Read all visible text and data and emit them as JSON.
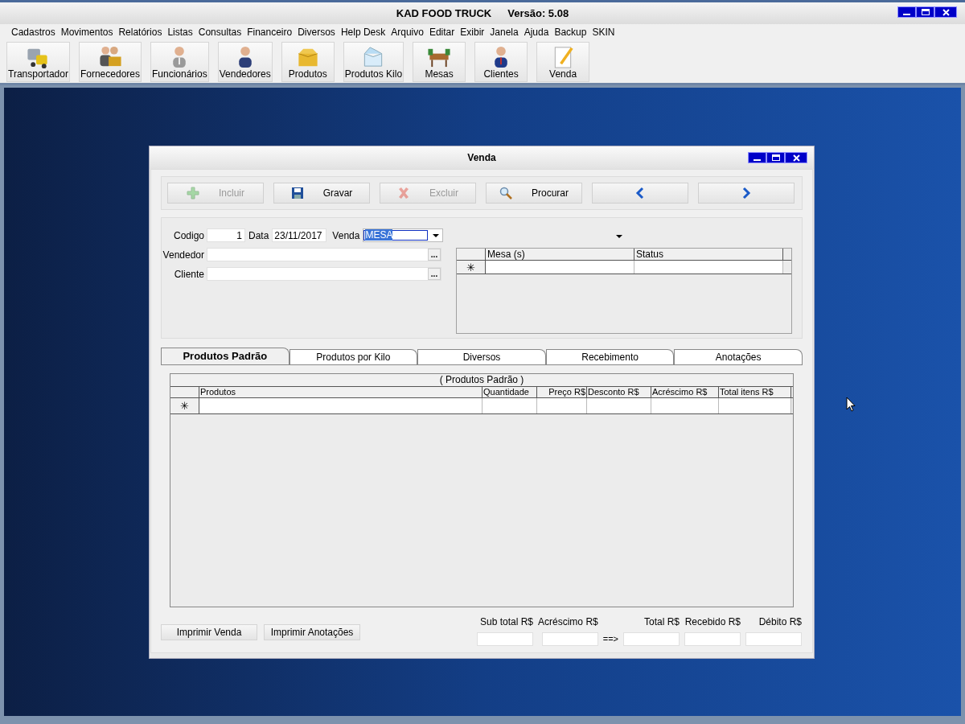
{
  "app": {
    "title": "KAD FOOD TRUCK",
    "version": "Versão: 5.08"
  },
  "menu": [
    "Cadastros",
    "Movimentos",
    "Relatórios",
    "Listas",
    "Consultas",
    "Financeiro",
    "Diversos",
    "Help Desk",
    "Arquivo",
    "Editar",
    "Exibir",
    "Janela",
    "Ajuda",
    "Backup",
    "SKIN"
  ],
  "toolbar": [
    {
      "label": "Transportador",
      "kind": "truck"
    },
    {
      "label": "Fornecedores",
      "kind": "suppliers"
    },
    {
      "label": "Funcionários",
      "kind": "employee"
    },
    {
      "label": "Vendedores",
      "kind": "seller"
    },
    {
      "label": "Produtos",
      "kind": "box"
    },
    {
      "label": "Produtos Kilo",
      "kind": "openbox"
    },
    {
      "label": "Mesas",
      "kind": "table"
    },
    {
      "label": "Clientes",
      "kind": "client"
    },
    {
      "label": "Venda",
      "kind": "note"
    }
  ],
  "window": {
    "title": "Venda",
    "toolbar": [
      {
        "label": "Incluir",
        "kind": "add",
        "disabled": true
      },
      {
        "label": "Gravar",
        "kind": "save",
        "disabled": false
      },
      {
        "label": "Excluir",
        "kind": "delete",
        "disabled": true
      },
      {
        "label": "Procurar",
        "kind": "search",
        "disabled": false
      },
      {
        "kind": "prev",
        "disabled": false
      },
      {
        "kind": "next",
        "disabled": false
      }
    ],
    "form": {
      "codigo": {
        "label": "Codigo",
        "value": "1"
      },
      "data": {
        "label": "Data",
        "value": "23/11/2017"
      },
      "venda": {
        "label": "Venda",
        "value": "MESA"
      },
      "vendedor": {
        "label": "Vendedor",
        "button": "..."
      },
      "cliente": {
        "label": "Cliente",
        "button": "..."
      }
    },
    "mesas_grid": {
      "columns": [
        "Mesa (s)",
        "Status"
      ],
      "new_row_marker": "✳"
    },
    "tabs": [
      {
        "label": "Produtos Padrão",
        "selected": true
      },
      {
        "label": "Produtos por Kilo",
        "selected": false
      },
      {
        "label": "Diversos",
        "selected": false
      },
      {
        "label": "Recebimento",
        "selected": false
      },
      {
        "label": "Anotações",
        "selected": false
      }
    ],
    "products_grid": {
      "title": "( Produtos Padrão )",
      "columns": [
        "Produtos",
        "Quantidade",
        "Preço R$",
        "Desconto R$",
        "Acréscimo R$",
        "Total itens R$"
      ],
      "new_row_marker": "✳"
    },
    "buttons": [
      "Imprimir Venda",
      "Imprimir Anotações"
    ],
    "totals": [
      "Sub total R$",
      "Acréscimo R$",
      "Total R$",
      "Recebido R$",
      "Débito R$"
    ],
    "arrow": "==>"
  }
}
